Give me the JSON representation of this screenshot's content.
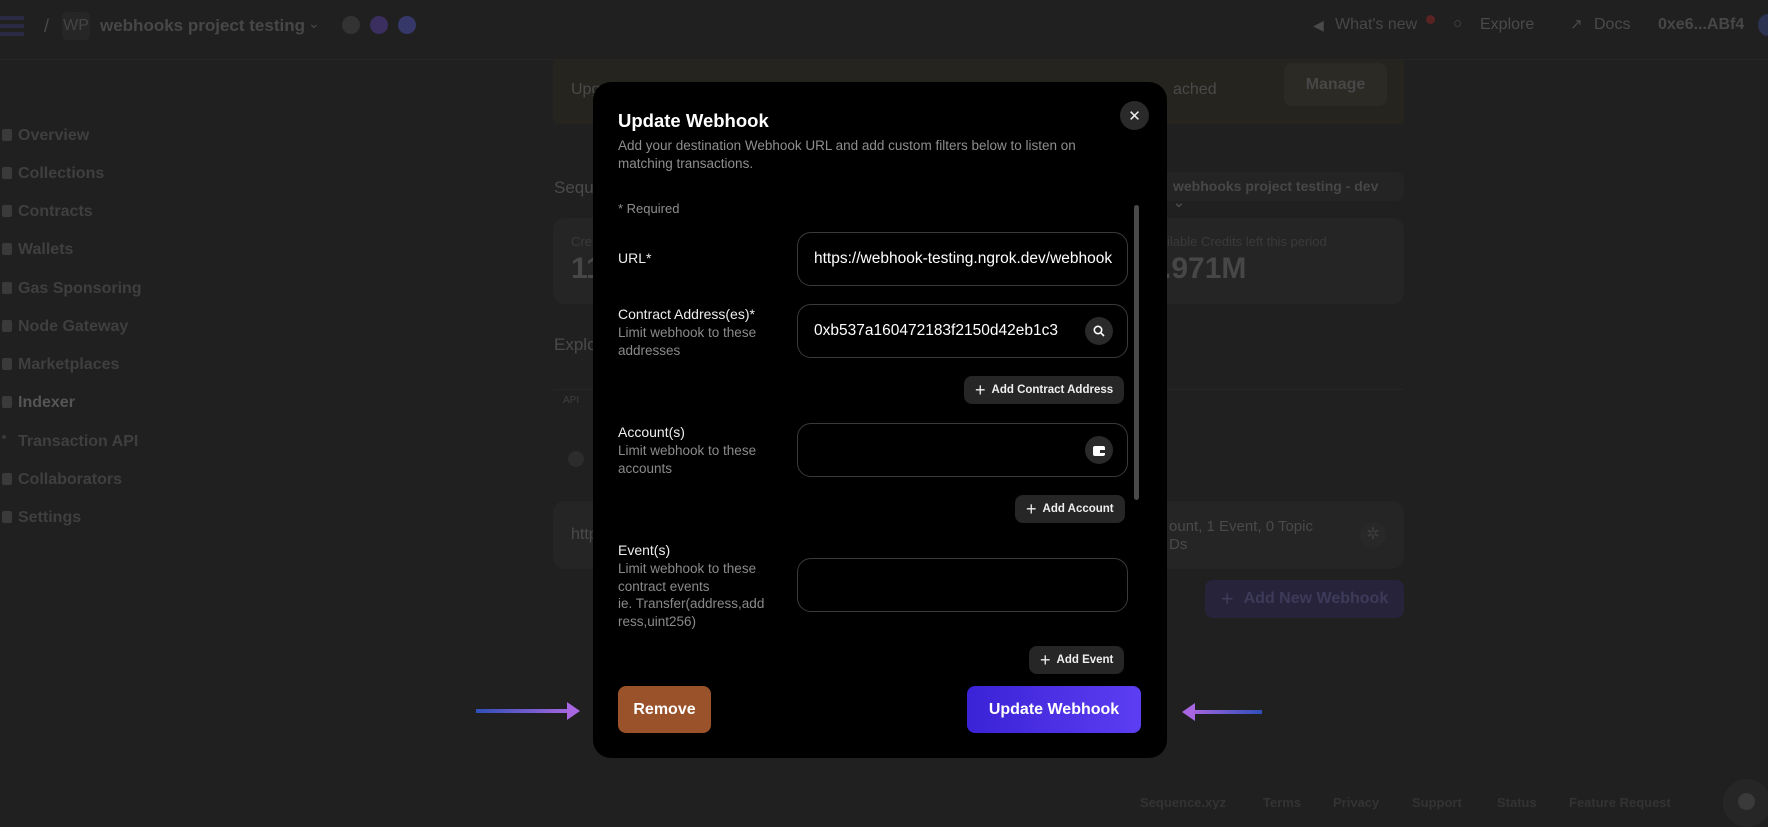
{
  "header": {
    "project_initials": "WP",
    "project_name": "webhooks project testing",
    "whats_new": "What's new",
    "explore": "Explore",
    "docs": "Docs",
    "account": "0xe6...ABf4"
  },
  "sidebar": {
    "items": [
      {
        "label": "Overview"
      },
      {
        "label": "Collections"
      },
      {
        "label": "Contracts"
      },
      {
        "label": "Wallets"
      },
      {
        "label": "Gas Sponsoring"
      },
      {
        "label": "Node Gateway"
      },
      {
        "label": "Marketplaces"
      },
      {
        "label": "Indexer"
      },
      {
        "label": "Transaction API"
      },
      {
        "label": "Collaborators"
      },
      {
        "label": "Settings"
      }
    ]
  },
  "background": {
    "banner_text_start": "Upg",
    "banner_text_end": "ached",
    "manage": "Manage",
    "section_seq": "Sequ",
    "env_select": "webhooks project testing - dev",
    "credits_label_start": "Cre",
    "credits_value_start": "11",
    "credits_label": "ilable Credits left this period",
    "credits_value": ".971M",
    "explore_title": "Explo",
    "api_tab": "API",
    "webhook_url_start": "http",
    "webhook_summary_1": "ount, 1 Event, 0 Topic",
    "webhook_summary_2": "Ds",
    "add_new_webhook": "Add New Webhook"
  },
  "footer": {
    "links": [
      "Sequence.xyz",
      "Terms",
      "Privacy",
      "Support",
      "Status",
      "Feature Request"
    ]
  },
  "modal": {
    "title": "Update Webhook",
    "description": "Add your destination Webhook URL and add custom filters below to listen on matching transactions.",
    "required_note": "* Required",
    "url": {
      "label": "URL*",
      "value": "https://webhook-testing.ngrok.dev/webhook"
    },
    "contract": {
      "label": "Contract Address(es)*",
      "hint": "Limit webhook to these addresses",
      "value": "0xb537a160472183f2150d42eb1c3",
      "add": "Add Contract Address"
    },
    "accounts": {
      "label": "Account(s)",
      "hint": "Limit webhook to these accounts",
      "value": "",
      "add": "Add Account"
    },
    "events": {
      "label": "Event(s)",
      "hint": "Limit webhook to these contract events",
      "example": "ie. Transfer(address,address,uint256)",
      "value": "",
      "add": "Add Event"
    },
    "remove": "Remove",
    "submit": "Update Webhook"
  },
  "colors": {
    "remove": "#9a522a",
    "submit_start": "#3a22d6",
    "submit_end": "#5d3ef2",
    "arrow_start": "#2f4fb8",
    "arrow_end": "#a866e0"
  }
}
